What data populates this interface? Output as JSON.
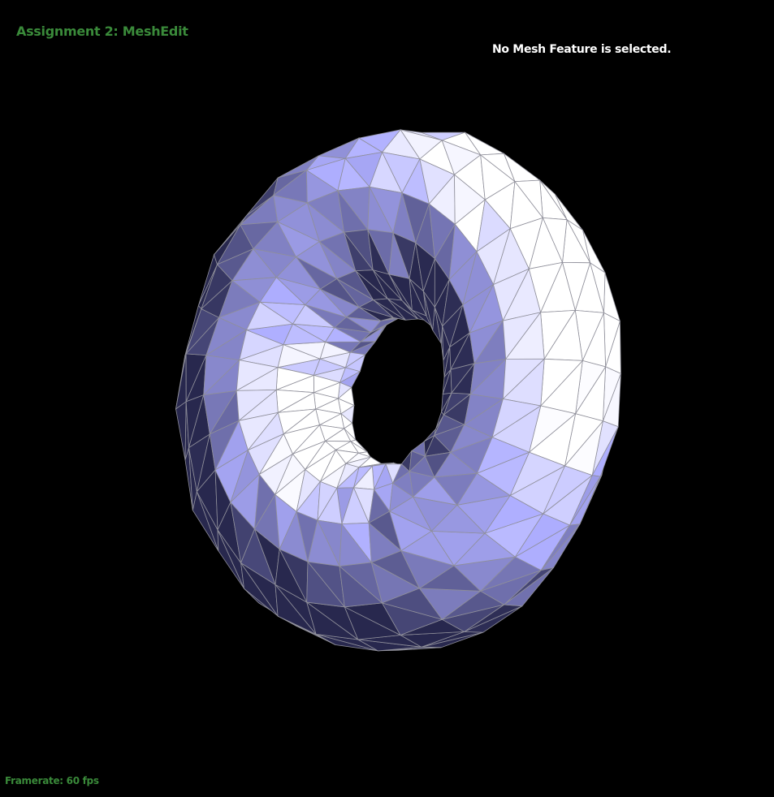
{
  "app": {
    "title": "Assignment 2: MeshEdit",
    "status_text": "No Mesh Feature is selected.",
    "framerate_text": "Framerate: 60 fps"
  },
  "viewport": {
    "object": "torus-mesh",
    "colors": {
      "background": "#000000",
      "overlay_text_green": "#3a8a3a",
      "overlay_text_white": "#ffffff",
      "wireframe": "#8f8f9a",
      "lit_face": "#ffffff",
      "mid_face": "#9a9cff",
      "shadow_face": "#2a2a4e"
    }
  }
}
